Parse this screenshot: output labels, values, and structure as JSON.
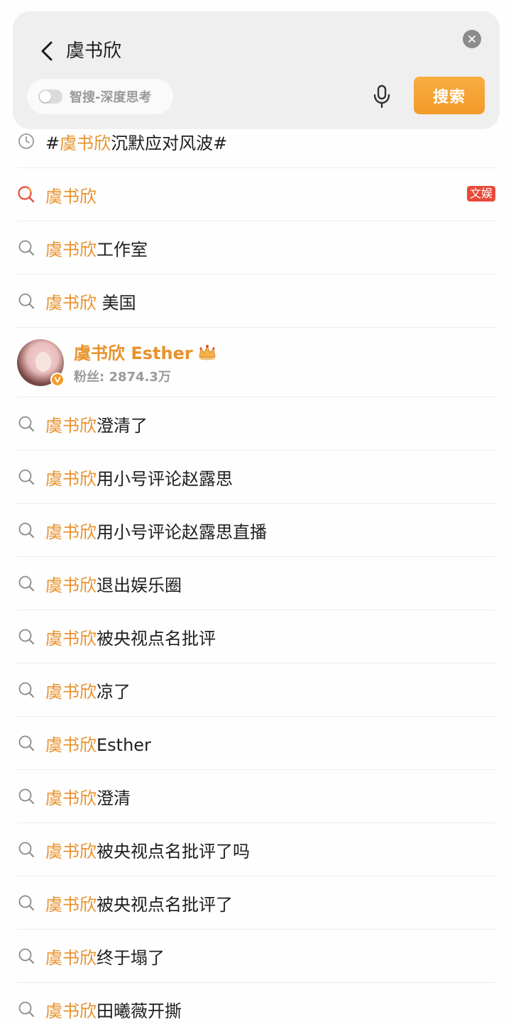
{
  "search": {
    "query": "虞书欣",
    "deep_toggle_label": "智搜-深度思考",
    "deep_toggle_on": false,
    "search_button_label": "搜索",
    "accent_color": "#f39b2b"
  },
  "suggestions": [
    {
      "type": "history",
      "icon": "clock-icon",
      "prefix": "#",
      "highlight": "虞书欣",
      "rest": "沉默应对风波#"
    },
    {
      "type": "hot",
      "icon": "search-hot-icon",
      "prefix": "",
      "highlight": "虞书欣",
      "rest": "",
      "tag": "文娱"
    },
    {
      "type": "search",
      "icon": "search-icon",
      "prefix": "",
      "highlight": "虞书欣",
      "rest": "工作室"
    },
    {
      "type": "search",
      "icon": "search-icon",
      "prefix": "",
      "highlight": "虞书欣",
      "rest": " 美国"
    }
  ],
  "user": {
    "name": "虞书欣 Esther",
    "fans_label": "粉丝: 2874.3万",
    "verified": true,
    "badge_icon": "crown-icon"
  },
  "more_suggestions": [
    {
      "highlight": "虞书欣",
      "rest": "澄清了"
    },
    {
      "highlight": "虞书欣",
      "rest": "用小号评论赵露思"
    },
    {
      "highlight": "虞书欣",
      "rest": "用小号评论赵露思直播"
    },
    {
      "highlight": "虞书欣",
      "rest": "退出娱乐圈"
    },
    {
      "highlight": "虞书欣",
      "rest": "被央视点名批评"
    },
    {
      "highlight": "虞书欣",
      "rest": "凉了"
    },
    {
      "highlight": "虞书欣",
      "rest": "Esther"
    },
    {
      "highlight": "虞书欣",
      "rest": "澄清"
    },
    {
      "highlight": "虞书欣",
      "rest": "被央视点名批评了吗"
    },
    {
      "highlight": "虞书欣",
      "rest": "被央视点名批评了"
    },
    {
      "highlight": "虞书欣",
      "rest": "终于塌了"
    },
    {
      "highlight": "虞书欣",
      "rest": "田曦薇开撕"
    }
  ]
}
